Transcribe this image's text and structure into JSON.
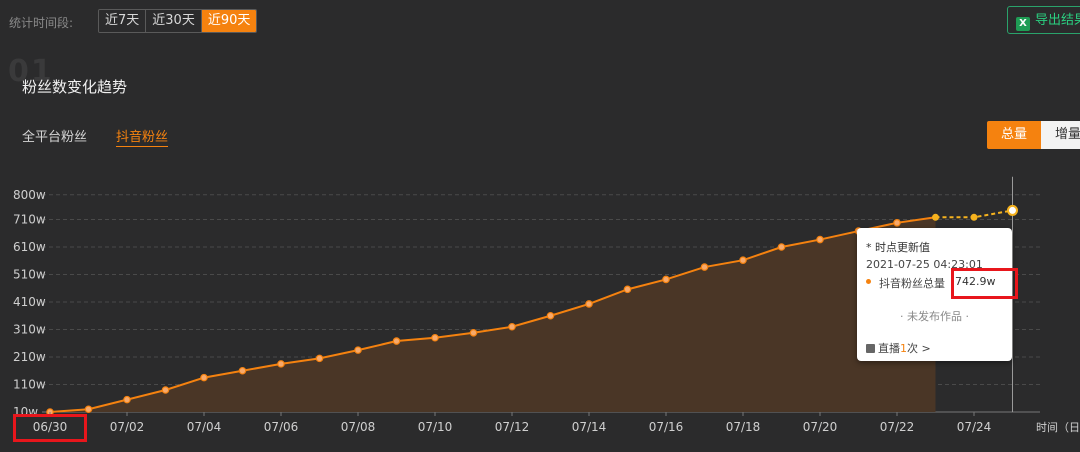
{
  "toolbar": {
    "period_label": "统计时间段:",
    "periods": [
      "近7天",
      "近30天",
      "近90天"
    ],
    "active_period": "近90天",
    "export_label": "导出结果",
    "export_icon": "excel-icon"
  },
  "section": {
    "number": "01",
    "title": "粉丝数变化趋势"
  },
  "platform_tabs": [
    {
      "label": "全平台粉丝",
      "active": false
    },
    {
      "label": "抖音粉丝",
      "active": true
    }
  ],
  "mode_toggle": {
    "options": [
      "总量",
      "增量"
    ],
    "active": "总量"
  },
  "tooltip": {
    "heading": "* 时点更新值",
    "time": "2021-07-25 04:23:01",
    "series": "抖音粉丝总量",
    "value": "742.9w",
    "note": "· 未发布作品 ·",
    "live_prefix": "直播",
    "live_count": "1",
    "live_suffix": "次 >"
  },
  "colors": {
    "accent": "#f5820f",
    "highlight": "#e8161c",
    "background": "#2b2b2c",
    "grid": "#4a4a4a",
    "area": "#4a3626",
    "export_green": "#2bd081"
  },
  "chart_data": {
    "type": "area",
    "x_unit_label": "时间（日",
    "xtick_labels": [
      "06/30",
      "07/02",
      "07/04",
      "07/06",
      "07/08",
      "07/10",
      "07/12",
      "07/14",
      "07/16",
      "07/18",
      "07/20",
      "07/22",
      "07/24"
    ],
    "ytick_labels": [
      "10w",
      "110w",
      "210w",
      "310w",
      "410w",
      "510w",
      "610w",
      "710w",
      "800w"
    ],
    "ytick_values": [
      10,
      110,
      210,
      310,
      410,
      510,
      610,
      710,
      800
    ],
    "ylim": [
      10,
      800
    ],
    "grid": true,
    "series": [
      {
        "name": "抖音粉丝总量",
        "x": [
          "06/30",
          "07/01",
          "07/02",
          "07/03",
          "07/04",
          "07/05",
          "07/06",
          "07/07",
          "07/08",
          "07/09",
          "07/10",
          "07/11",
          "07/12",
          "07/13",
          "07/14",
          "07/15",
          "07/16",
          "07/17",
          "07/18",
          "07/19",
          "07/20",
          "07/21",
          "07/22",
          "07/23",
          "07/24",
          "07/25"
        ],
        "values": [
          10,
          20,
          55,
          90,
          135,
          160,
          185,
          205,
          235,
          268,
          280,
          298,
          320,
          360,
          403,
          456,
          492,
          537,
          562,
          610,
          637,
          668,
          698,
          718,
          718,
          743
        ]
      }
    ]
  }
}
